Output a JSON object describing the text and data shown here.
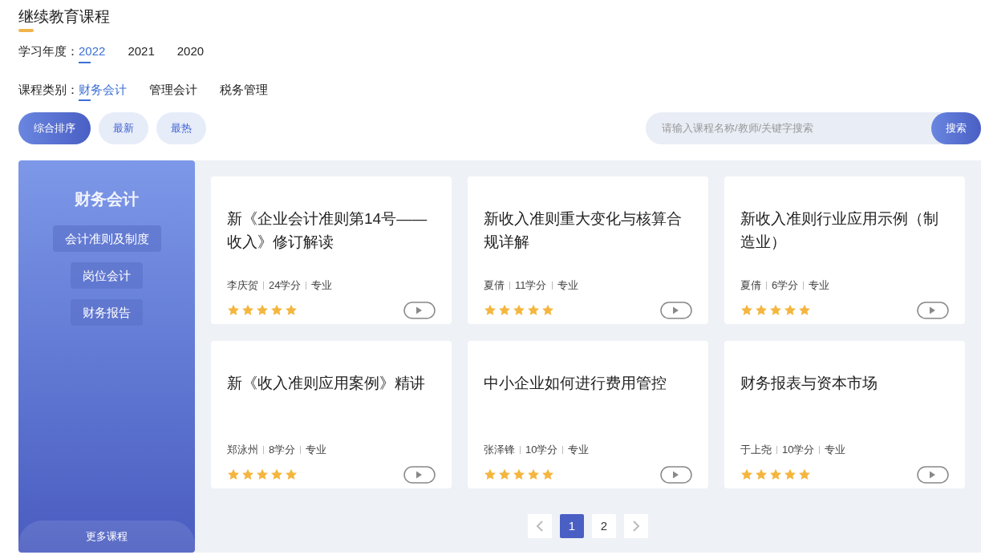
{
  "title": "继续教育课程",
  "year_filter": {
    "label": "学习年度：",
    "options": [
      {
        "label": "2022",
        "selected": true
      },
      {
        "label": "2021",
        "selected": false
      },
      {
        "label": "2020",
        "selected": false
      }
    ]
  },
  "category_filter": {
    "label": "课程类别：",
    "options": [
      {
        "label": "财务会计",
        "selected": true
      },
      {
        "label": "管理会计",
        "selected": false
      },
      {
        "label": "税务管理",
        "selected": false
      }
    ]
  },
  "sort_tabs": [
    {
      "label": "综合排序",
      "selected": true
    },
    {
      "label": "最新",
      "selected": false
    },
    {
      "label": "最热",
      "selected": false
    }
  ],
  "search": {
    "placeholder": "请输入课程名称/教师/关键字搜索",
    "button": "搜索"
  },
  "sidebar": {
    "title": "财务会计",
    "items": [
      "会计准则及制度",
      "岗位会计",
      "财务报告"
    ],
    "more": "更多课程"
  },
  "courses": [
    {
      "title": "新《企业会计准则第14号——收入》修订解读",
      "teacher": "李庆贺",
      "credits": "24学分",
      "type": "专业",
      "stars": 5
    },
    {
      "title": "新收入准则重大变化与核算合规详解",
      "teacher": "夏倩",
      "credits": "11学分",
      "type": "专业",
      "stars": 5
    },
    {
      "title": "新收入准则行业应用示例（制造业）",
      "teacher": "夏倩",
      "credits": "6学分",
      "type": "专业",
      "stars": 5
    },
    {
      "title": "新《收入准则应用案例》精讲",
      "teacher": "郑泳州",
      "credits": "8学分",
      "type": "专业",
      "stars": 5
    },
    {
      "title": "中小企业如何进行费用管控",
      "teacher": "张泽锋",
      "credits": "10学分",
      "type": "专业",
      "stars": 5
    },
    {
      "title": "财务报表与资本市场",
      "teacher": "于上尧",
      "credits": "10学分",
      "type": "专业",
      "stars": 5
    }
  ],
  "pagination": {
    "pages": [
      {
        "label": "1",
        "selected": true
      },
      {
        "label": "2",
        "selected": false
      }
    ]
  }
}
